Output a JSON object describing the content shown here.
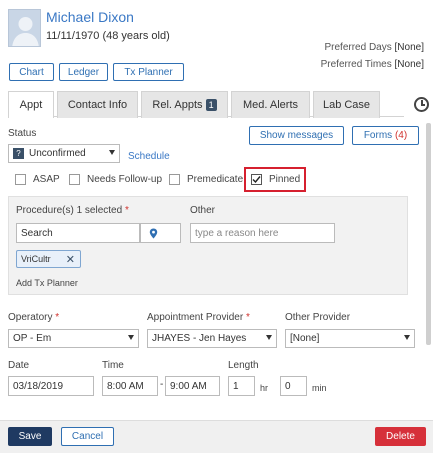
{
  "patient": {
    "name": "Michael Dixon",
    "dob": "11/11/1970 (48 years old)",
    "preferred_days_label": "Preferred Days",
    "preferred_days_value": "[None]",
    "preferred_times_label": "Preferred Times",
    "preferred_times_value": "[None]"
  },
  "toolbar": {
    "chart": "Chart",
    "ledger": "Ledger",
    "tx_planner": "Tx Planner"
  },
  "tabs": [
    {
      "label": "Appt",
      "active": true
    },
    {
      "label": "Contact Info"
    },
    {
      "label": "Rel. Appts",
      "badge": "1"
    },
    {
      "label": "Med. Alerts"
    },
    {
      "label": "Lab Case"
    }
  ],
  "status": {
    "label": "Status",
    "value": "Unconfirmed",
    "icon_glyph": "?",
    "schedule_link": "Schedule"
  },
  "actions": {
    "show_messages": "Show messages",
    "forms_label": "Forms",
    "forms_count": "(4)"
  },
  "flags": [
    {
      "label": "ASAP",
      "checked": false
    },
    {
      "label": "Needs Follow-up",
      "checked": false
    },
    {
      "label": "Premedicate",
      "checked": false
    },
    {
      "label": "Pinned",
      "checked": true
    }
  ],
  "procedures": {
    "label": "Procedure(s)",
    "selected_text": "1 selected",
    "required_mark": "*",
    "search_value": "Search",
    "other_label": "Other",
    "other_placeholder": "type a reason here",
    "tag": "VriCultr",
    "add_tx_planner": "Add Tx Planner"
  },
  "operatory": {
    "label": "Operatory",
    "required_mark": "*",
    "value": "OP - Em"
  },
  "appointment_provider": {
    "label": "Appointment Provider",
    "required_mark": "*",
    "value": "JHAYES - Jen Hayes"
  },
  "other_provider": {
    "label": "Other Provider",
    "value": "[None]"
  },
  "date": {
    "label": "Date",
    "value": "03/18/2019"
  },
  "time": {
    "label": "Time",
    "start": "8:00 AM",
    "separator": "-",
    "end": "9:00 AM"
  },
  "length": {
    "label": "Length",
    "hours": "1",
    "hr_unit": "hr",
    "minutes": "0",
    "min_unit": "min"
  },
  "footer": {
    "save": "Save",
    "cancel": "Cancel",
    "delete": "Delete"
  },
  "colors": {
    "accent": "#2f6fb2",
    "primary_dark": "#1f3a62",
    "danger": "#d6303a",
    "highlight_box": "#d6202f"
  }
}
